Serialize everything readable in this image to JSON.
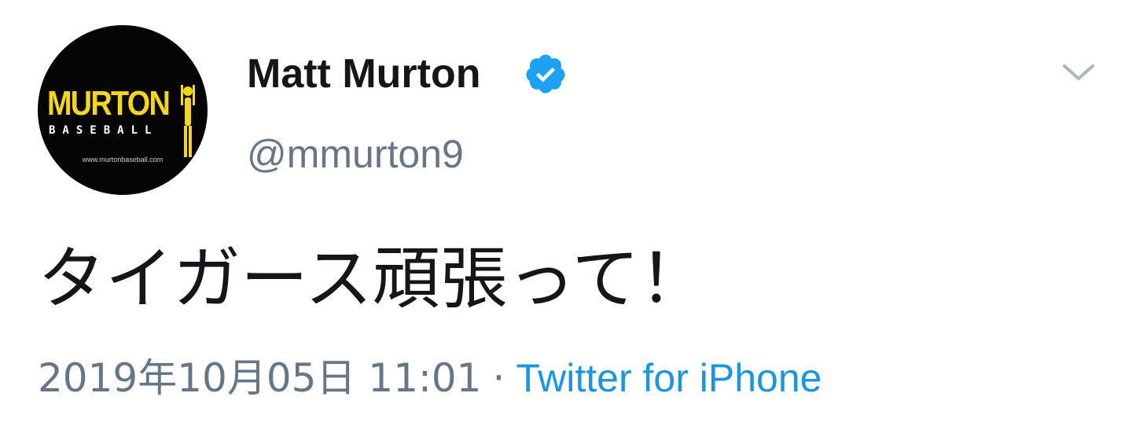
{
  "author": {
    "display_name": "Matt Murton",
    "handle": "@mmurton9",
    "verified": true,
    "avatar": {
      "logo_word": "MURTON",
      "logo_sub": "BASEBALL",
      "logo_url": "www.murtonbaseball.com"
    }
  },
  "tweet": {
    "text": "タイガース頑張って！",
    "timestamp": "2019年10月05日 11:01",
    "separator": "·",
    "source": "Twitter for iPhone"
  },
  "colors": {
    "text_primary": "#14171a",
    "text_secondary": "#657786",
    "link": "#1b95e0",
    "verified_badge": "#1da1f2",
    "logo_yellow": "#f2d71b"
  },
  "icons": {
    "verified": "verified-badge-icon",
    "menu": "chevron-down-icon"
  }
}
